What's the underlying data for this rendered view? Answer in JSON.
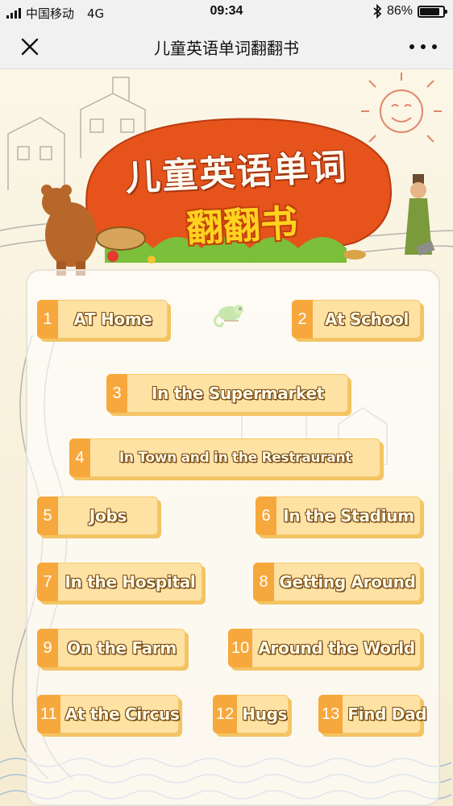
{
  "status_bar": {
    "carrier": "中国移动",
    "network": "4G",
    "time": "09:34",
    "battery": "86%",
    "battery_level": 0.86,
    "icons": [
      "signal-icon",
      "bluetooth-icon",
      "battery-icon"
    ]
  },
  "nav": {
    "title": "儿童英语单词翻翻书",
    "icons": [
      "close-icon",
      "more-icon"
    ]
  },
  "banner": {
    "title": "儿童英语单词",
    "subtitle": "翻翻书"
  },
  "words": [
    {
      "num": "1",
      "label": "AT Home"
    },
    {
      "num": "2",
      "label": "At School"
    },
    {
      "num": "3",
      "label": "In the Supermarket"
    },
    {
      "num": "4",
      "label": "In Town and in the Restraurant"
    },
    {
      "num": "5",
      "label": "Jobs"
    },
    {
      "num": "6",
      "label": "In the Stadium"
    },
    {
      "num": "7",
      "label": "In the Hospital"
    },
    {
      "num": "8",
      "label": "Getting Around"
    },
    {
      "num": "9",
      "label": "On the Farm"
    },
    {
      "num": "10",
      "label": "Around the World"
    },
    {
      "num": "11",
      "label": "At the Circus"
    },
    {
      "num": "12",
      "label": "Hugs"
    },
    {
      "num": "13",
      "label": "Find Dad"
    }
  ],
  "colors": {
    "button_face": "#fde2a4",
    "button_number": "#f7a83c",
    "banner_red": "#e6531b",
    "banner_yellow": "#ffd21f"
  }
}
